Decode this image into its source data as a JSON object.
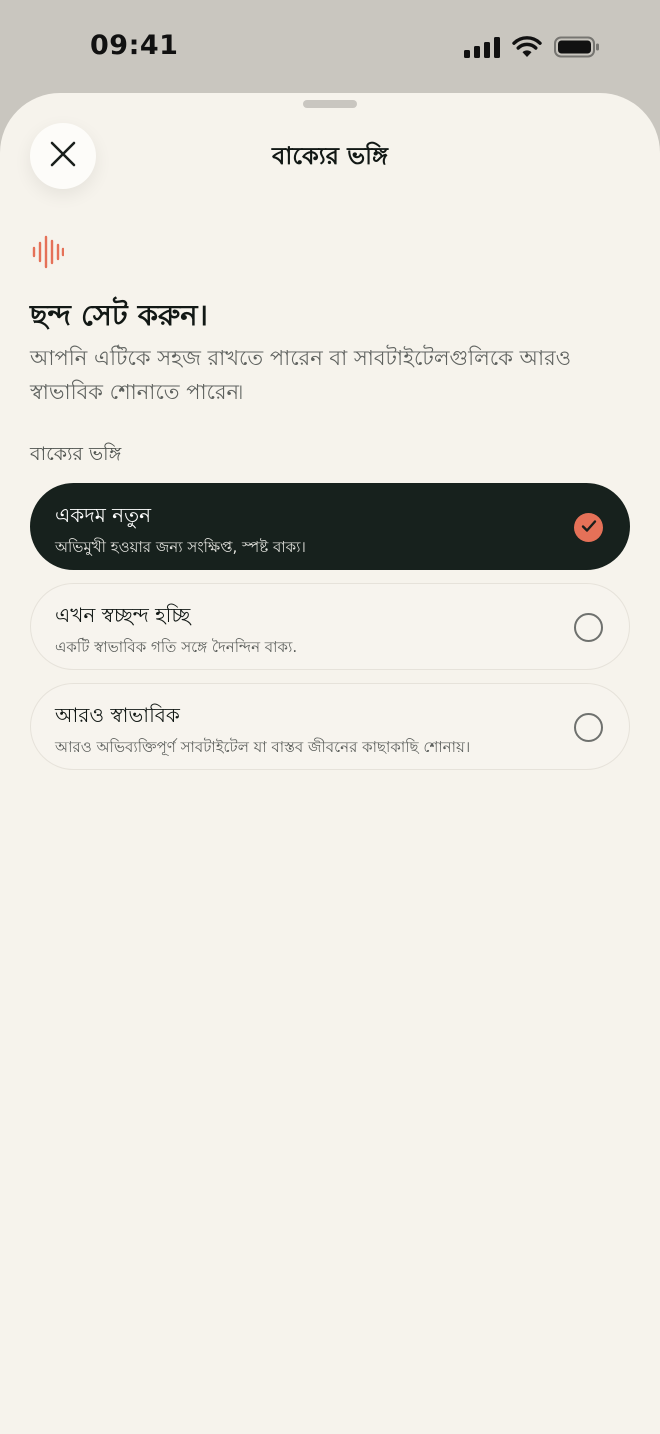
{
  "status_bar": {
    "time": "09:41",
    "icons": [
      "signal-icon",
      "wifi-icon",
      "battery-icon"
    ]
  },
  "sheet": {
    "title": "বাক্যের ভঙ্গি",
    "close_icon": "close-icon",
    "header_icon": "audio-wave-icon"
  },
  "intro": {
    "heading": "ছন্দ সেট করুন।",
    "description": "আপনি এটিকে সহজ রাখতে পারেন বা সাবটাইটেলগুলিকে আরও স্বাভাবিক শোনাতে পারেন৷"
  },
  "style_section": {
    "label": "বাক্যের ভঙ্গি",
    "options": [
      {
        "title": "একদম নতুন",
        "subtitle": "অভিমুখী হওয়ার জন্য সংক্ষিপ্ত, স্পষ্ট বাক্য।",
        "selected": true
      },
      {
        "title": "এখন স্বচ্ছন্দ হচ্ছি",
        "subtitle": "একটি স্বাভাবিক গতি সঙ্গে দৈনন্দিন বাক্য.",
        "selected": false
      },
      {
        "title": "আরও স্বাভাবিক",
        "subtitle": "আরও অভিব্যক্তিপূর্ণ সাবটাইটেল যা বাস্তব জীবনের কাছাকাছি শোনায়।",
        "selected": false
      }
    ]
  },
  "colors": {
    "background": "#f6f3ec",
    "selected_card": "#17211d",
    "accent": "#e57158",
    "status_bar_bg": "#c9c6bf"
  }
}
